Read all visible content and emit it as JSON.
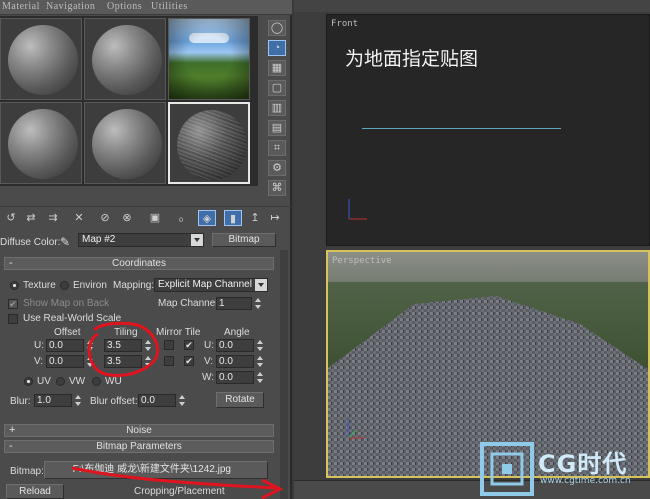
{
  "material_editor": {
    "menu": [
      "Material",
      "Navigation",
      "Options",
      "Utilities"
    ],
    "slots": [
      {
        "name": "slot-1",
        "kind": "gray"
      },
      {
        "name": "slot-2",
        "kind": "gray"
      },
      {
        "name": "slot-3",
        "kind": "environment"
      },
      {
        "name": "slot-4",
        "kind": "gray"
      },
      {
        "name": "slot-5",
        "kind": "gray"
      },
      {
        "name": "slot-6",
        "kind": "stone"
      }
    ],
    "diffuse_color_label": "Diffuse Color:",
    "map_name": "Map #2",
    "map_type_button": "Bitmap",
    "coordinates": {
      "title": "Coordinates",
      "collapse_sign": "-",
      "texture_label": "Texture",
      "environ_label": "Environ",
      "mapping_label": "Mapping:",
      "mapping_value": "Explicit Map Channel",
      "show_map_on_back": "Show Map on Back",
      "map_channel_label": "Map Channel:",
      "map_channel_value": "1",
      "use_real_world_scale": "Use Real-World Scale",
      "offset_header": "Offset",
      "tiling_header": "Tiling",
      "mirror_tile_header": "Mirror Tile",
      "angle_header": "Angle",
      "u_label": "U:",
      "v_label": "V:",
      "w_label": "W:",
      "offset_u": "0.0",
      "offset_v": "0.0",
      "tiling_u": "3.5",
      "tiling_v": "3.5",
      "angle_u": "0.0",
      "angle_v": "0.0",
      "angle_w": "0.0",
      "uv_label": "UV",
      "vw_label": "VW",
      "wu_label": "WU",
      "blur_label": "Blur:",
      "blur_value": "1.0",
      "blur_offset_label": "Blur offset:",
      "blur_offset_value": "0.0",
      "rotate_button": "Rotate"
    },
    "noise": {
      "title": "Noise",
      "collapse_sign": "+"
    },
    "bitmap_params": {
      "title": "Bitmap Parameters",
      "collapse_sign": "-",
      "bitmap_label": "Bitmap:",
      "bitmap_path": "F:\\布伽迪 威龙\\新建文件夹\\1242.jpg",
      "reload_button": "Reload",
      "cropping_label": "Cropping/Placement"
    },
    "check_mark": "✔"
  },
  "viewports": {
    "front_label": "Front",
    "perspective_label": "Perspective",
    "annotation": "为地面指定贴图"
  },
  "watermark": {
    "brand": "CG时代",
    "url": "www.cgtime.com.cn"
  },
  "colors": {
    "annotation_red": "#e0141e",
    "viewport_active": "#d8c25c",
    "active_tool": "#3f6ea8"
  }
}
